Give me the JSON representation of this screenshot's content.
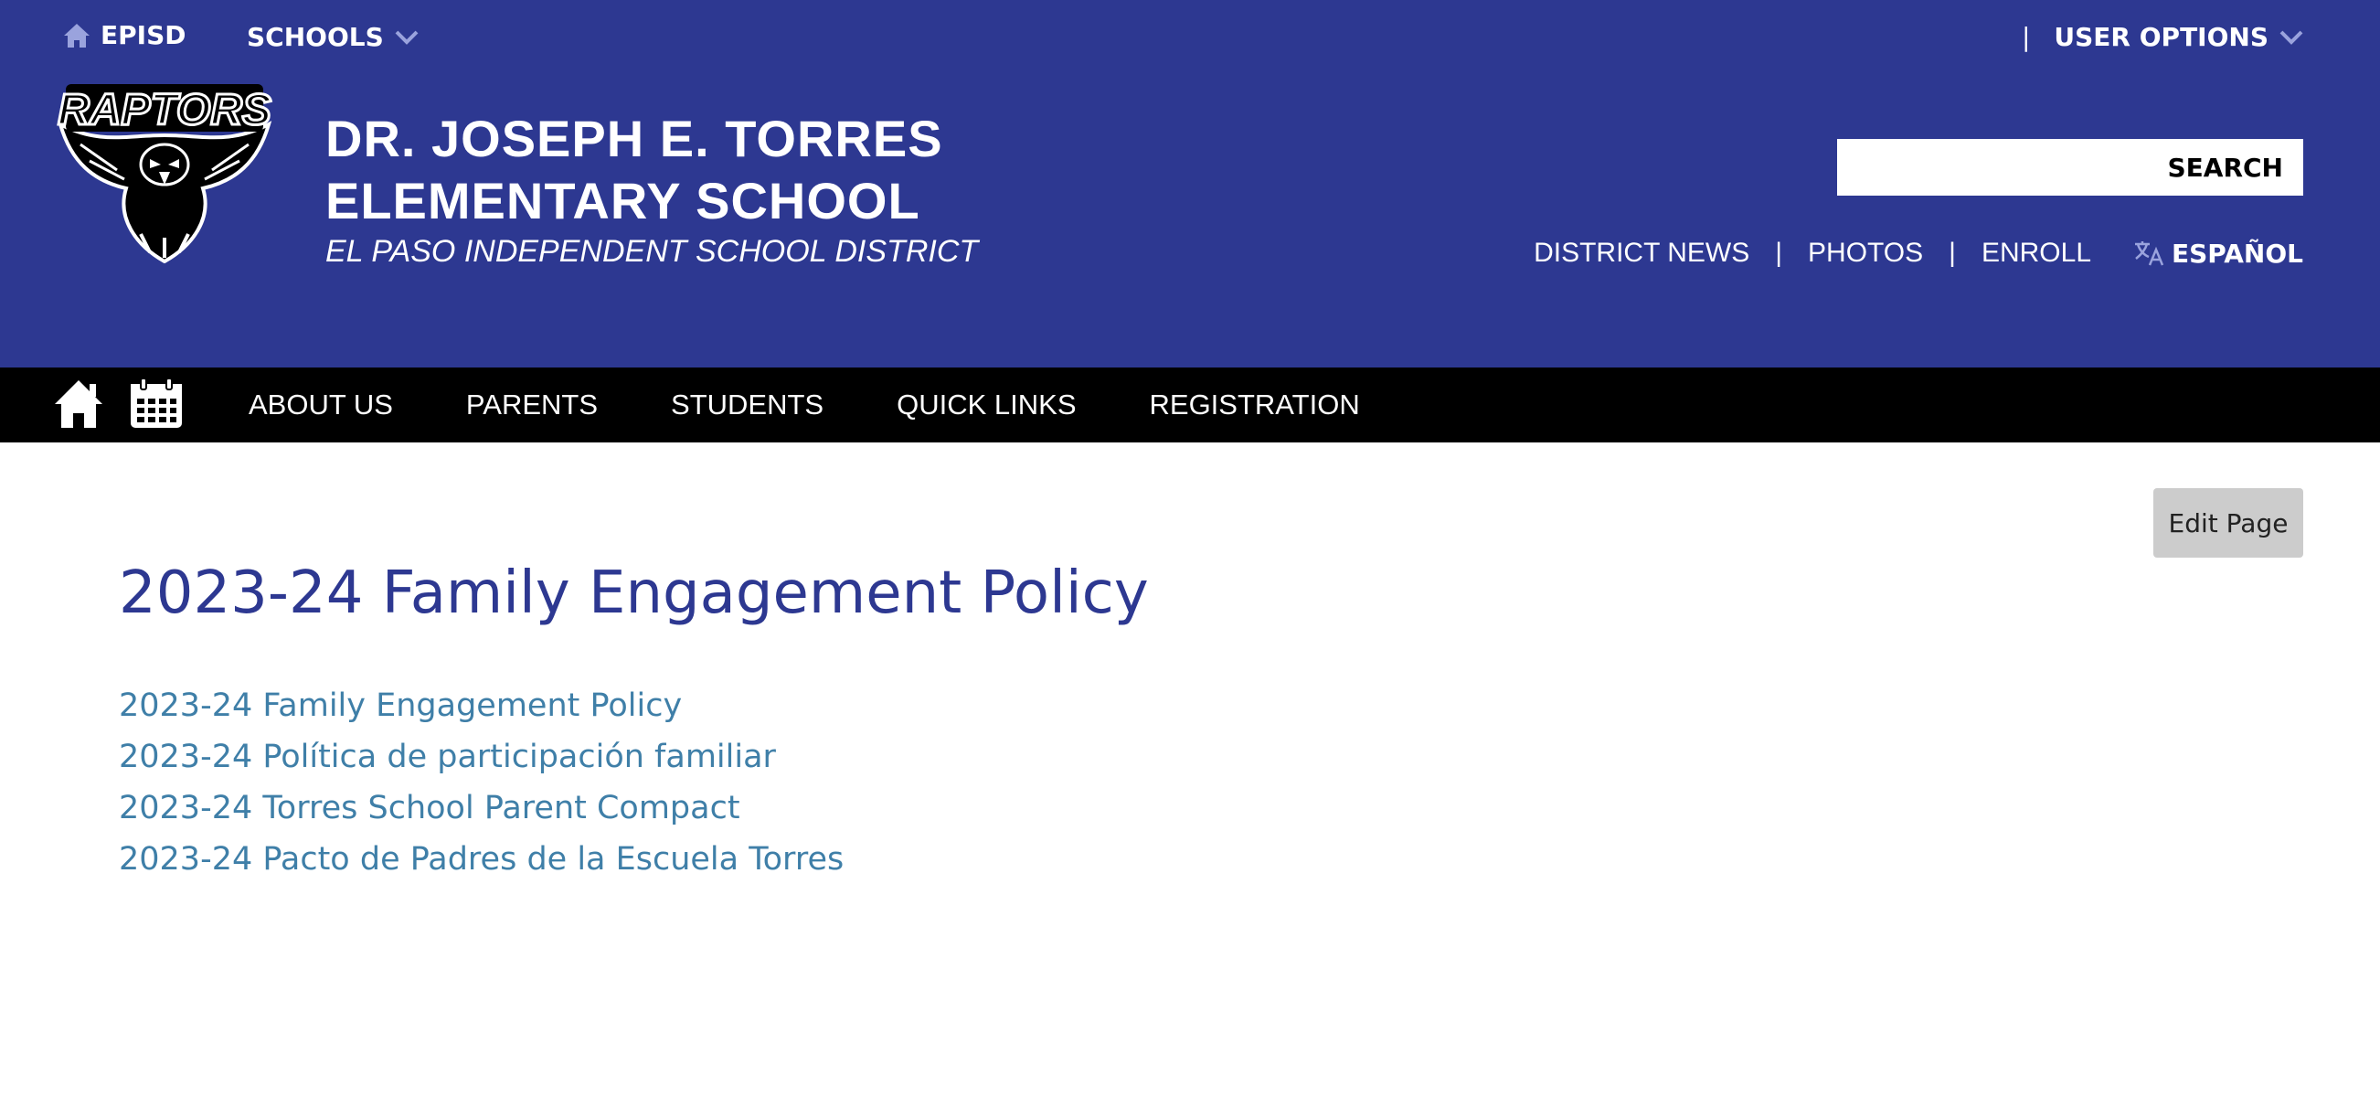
{
  "utility": {
    "home_label": "EPISD",
    "schools_label": "SCHOOLS",
    "user_options_label": "USER OPTIONS"
  },
  "school": {
    "name_line1": "DR. JOSEPH E. TORRES",
    "name_line2": "ELEMENTARY SCHOOL",
    "district": "EL PASO INDEPENDENT SCHOOL DISTRICT",
    "logo_text": "RAPTORS"
  },
  "search": {
    "label": "SEARCH",
    "value": ""
  },
  "top_links": [
    "DISTRICT NEWS",
    "PHOTOS",
    "ENROLL"
  ],
  "language": "ESPAÑOL",
  "nav": [
    "ABOUT US",
    "PARENTS",
    "STUDENTS",
    "QUICK LINKS",
    "REGISTRATION"
  ],
  "edit_button": "Edit Page",
  "page_title": "2023-24 Family Engagement Policy",
  "documents": [
    "2023-24 Family Engagement Policy",
    "2023-24 Política de participación familiar",
    "2023-24 Torres School Parent Compact",
    "2023-24 Pacto de Padres de la Escuela Torres"
  ],
  "colors": {
    "header_bg": "#2d3891",
    "nav_bg": "#000000",
    "title": "#2d3891",
    "link": "#3f7fa8"
  }
}
